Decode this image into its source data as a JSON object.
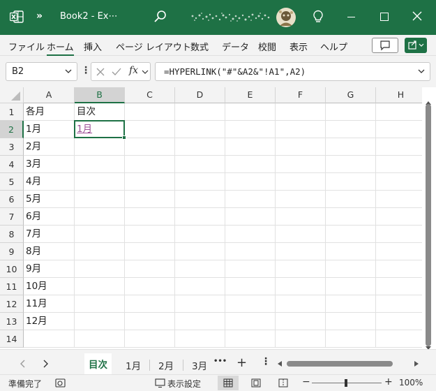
{
  "titlebar": {
    "title": "Book2  -  Ex⋯",
    "chevron": "»",
    "colors": {
      "brand": "#1e7145"
    }
  },
  "menu": {
    "items": [
      "ファイル",
      "ホーム",
      "挿入",
      "ページ レイアウト",
      "数式",
      "データ",
      "校閲",
      "表示",
      "ヘルプ"
    ],
    "active": "ホーム"
  },
  "formula_bar": {
    "name_box": "B2",
    "formula": "=HYPERLINK(\"#\"&A2&\"!A1\",A2)",
    "fx_label": "fx"
  },
  "grid": {
    "columns": [
      "A",
      "B",
      "C",
      "D",
      "E",
      "F",
      "G",
      "H"
    ],
    "selected_column": "B",
    "rows": [
      "1",
      "2",
      "3",
      "4",
      "5",
      "6",
      "7",
      "8",
      "9",
      "10",
      "11",
      "12",
      "13",
      "14"
    ],
    "selected_row": "2",
    "cells": {
      "A1": "各月",
      "B1": "目次",
      "A2": "1月",
      "B2": "1月",
      "A3": "2月",
      "A4": "3月",
      "A5": "4月",
      "A6": "5月",
      "A7": "6月",
      "A8": "7月",
      "A9": "8月",
      "A10": "9月",
      "A11": "10月",
      "A12": "11月",
      "A13": "12月"
    },
    "hyperlink_cell": "B2",
    "active_cell": "B2"
  },
  "sheets": {
    "tabs": [
      "目次",
      "1月",
      "2月",
      "3月"
    ],
    "active": "目次",
    "more": "•••",
    "add": "+"
  },
  "statusbar": {
    "ready": "準備完了",
    "display_settings": "表示設定",
    "zoom": "100%",
    "zoom_minus": "−",
    "zoom_plus": "+"
  }
}
